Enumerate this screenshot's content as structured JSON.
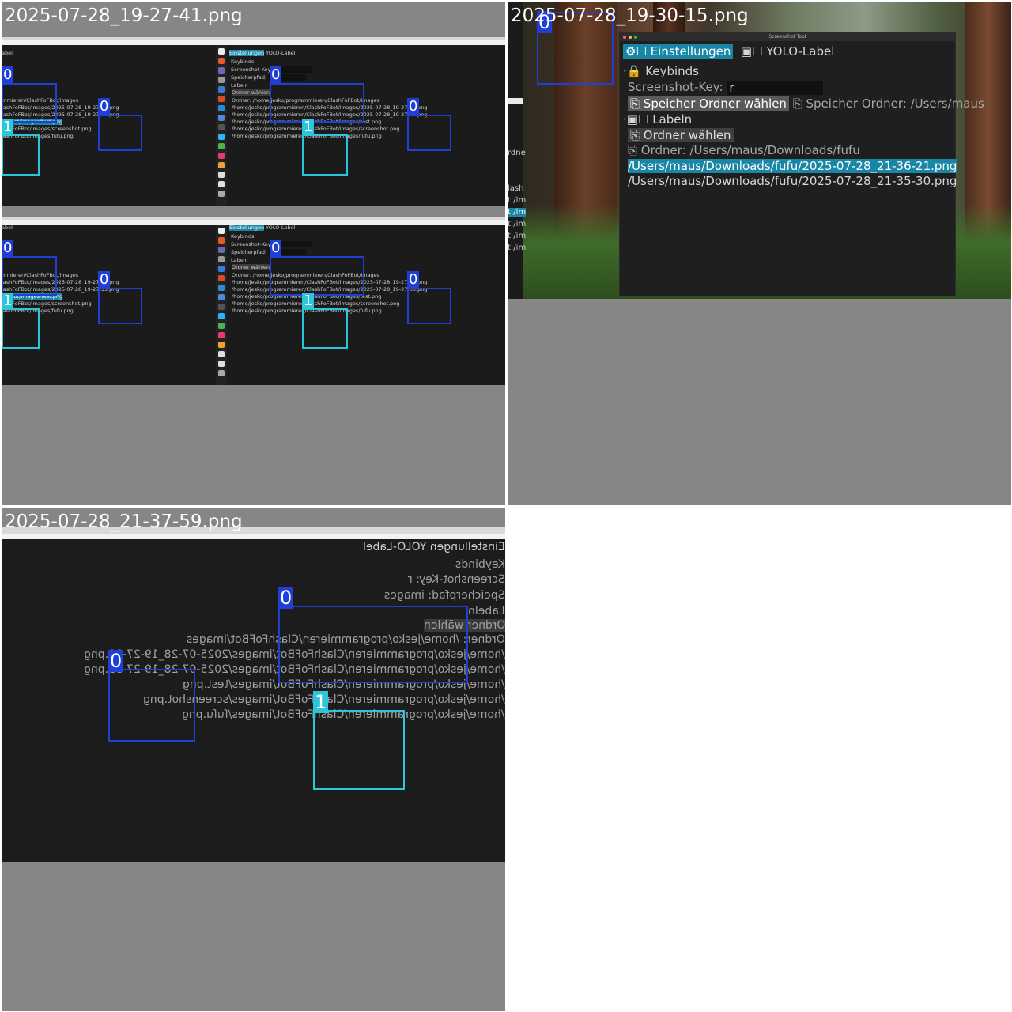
{
  "tiles": [
    {
      "title": "2025-07-28_19-27-41.png",
      "mini": {
        "settings_tab": "Einstellungen",
        "yolo_tab": "YOLO-Label",
        "keybinds": "Keybinds",
        "screenshot_key": "Screenshot-Key:",
        "speicherpfad": "Speicherpfad:",
        "labeln": "Labeln",
        "ordner_waehlen": "Ordner wählen",
        "ordner_path": "Ordner: /home/jesko/programmieren/ClashFoFBot/images",
        "files": [
          "/home/jesko/programmieren/ClashFoFBot/images/2025-07-28_19-27-39.png",
          "/home/jesko/programmieren/ClashFoFBot/images/2025-07-28_19-27-35.png",
          "/home/jesko/programmieren/ClashFoFBot/images/test.png",
          "/home/jesko/programmieren/ClashFoFBot/images/screenshot.png",
          "/home/jesko/programmieren/ClashFoFBot/images/fufu.png"
        ],
        "left_frag_label": "abel",
        "left_frag_path": "mmieren/ClashFoFBot/images",
        "left_files": [
          "lashFoFBot/images/2025-07-28_19-27-39.png",
          "lashFoFBot/images/2025-07-28_19-27-35.png",
          "FoFBot/images/test.png",
          "lashFoFBot/images/screenshot.png",
          "lashFoFBot/images/fufu.png"
        ]
      },
      "labels": {
        "zero": "0",
        "one": "1"
      }
    },
    {
      "title": "2025-07-28_19-30-15.png",
      "window_title": "Screenshot Tool",
      "tabs": {
        "settings": "Einstellungen",
        "yolo": "YOLO-Label"
      },
      "keybinds": "Keybinds",
      "screenshot_key_label": "Screenshot-Key:",
      "screenshot_key_value": "r",
      "save_folder_button": "Speicher Ordner wählen",
      "save_folder_path": "Speicher Ordner: /Users/maus",
      "labeln": "Labeln",
      "choose_folder_button": "Ordner wählen",
      "folder_path": "Ordner: /Users/maus/Downloads/fufu",
      "files": [
        "/Users/maus/Downloads/fufu/2025-07-28_21-36-21.png",
        "/Users/maus/Downloads/fufu/2025-07-28_21-35-30.png"
      ],
      "left_strip": [
        "rdne",
        "lash",
        "t:/im",
        "t:/im",
        "t:/im",
        "t:/im",
        "t:/im"
      ],
      "labels": {
        "zero": "0"
      }
    },
    {
      "title": "2025-07-28_21-37-59.png",
      "mirrored_rows": [
        "Einstellungen  YOLO-Label",
        "Keybinds",
        "Screenshot-Key: r",
        "Speicherpfad: images",
        "Labeln",
        "Ordner wählen",
        "Ordner: /home/jesko/programmieren/ClashFoFBot/images",
        "/home/jesko/programmieren/ClashFoFBot/images/2025-07-28_19-27-39.png",
        "/home/jesko/programmieren/ClashFoFBot/images/2025-07-28_19-27-35.png",
        "/home/jesko/programmieren/ClashFoFBot/images/test.png",
        "/home/jesko/programmieren/ClashFoFBot/images/screenshot.png",
        "/home/jesko/programmieren/ClashFoFBot/images/fufu.png"
      ],
      "labels": {
        "zero": "0",
        "one": "1"
      }
    }
  ],
  "colors": {
    "tile_bg": "#868686",
    "panel_bg": "#1c1c1c",
    "accent_tab": "#1a86a6",
    "class0_box": "#1f3fd6",
    "class1_box": "#2ac6dc"
  }
}
